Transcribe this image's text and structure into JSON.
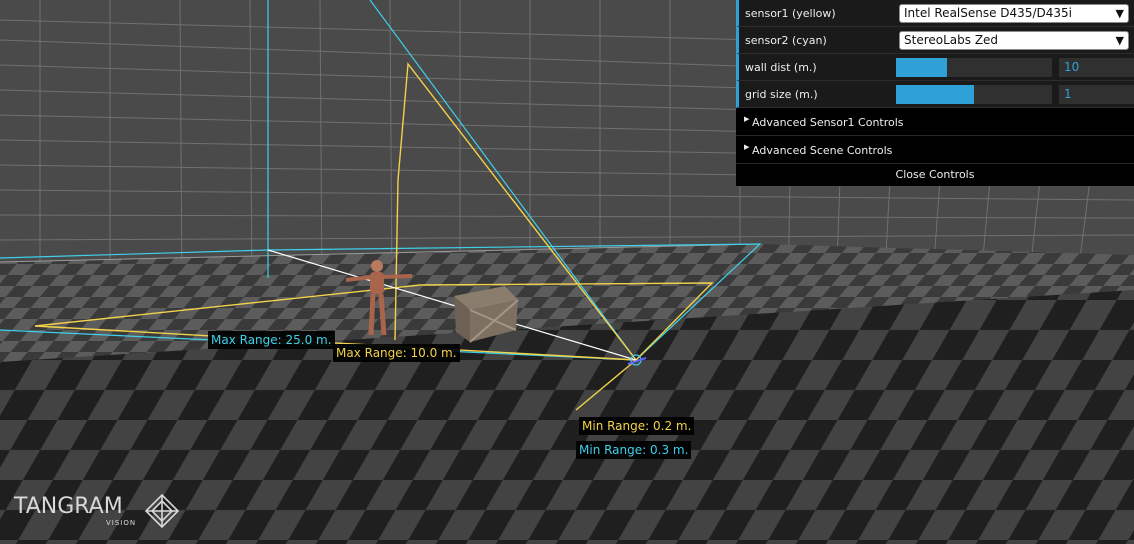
{
  "controls": {
    "sensor1": {
      "label": "sensor1 (yellow)",
      "value": "Intel RealSense D435/D435i"
    },
    "sensor2": {
      "label": "sensor2 (cyan)",
      "value": "StereoLabs Zed"
    },
    "wall_dist": {
      "label": "wall dist (m.)",
      "value": "10",
      "fraction": 0.33
    },
    "grid_size": {
      "label": "grid size (m.)",
      "value": "1",
      "fraction": 0.5
    },
    "folders": [
      {
        "label": "Advanced Sensor1 Controls"
      },
      {
        "label": "Advanced Scene Controls"
      }
    ],
    "close_label": "Close Controls"
  },
  "scene": {
    "labels": {
      "cyan_max": "Max Range: 25.0 m.",
      "yellow_max": "Max Range: 10.0 m.",
      "yellow_min": "Min Range: 0.2 m.",
      "cyan_min": "Min Range: 0.3 m."
    },
    "colors": {
      "yellow": "#f2d24a",
      "cyan": "#3fd0ea",
      "accent": "#2fa1d6"
    }
  },
  "logo": {
    "word": "TANGRAM",
    "sub": "VISION",
    "icon": "tangram-diamond-icon"
  }
}
